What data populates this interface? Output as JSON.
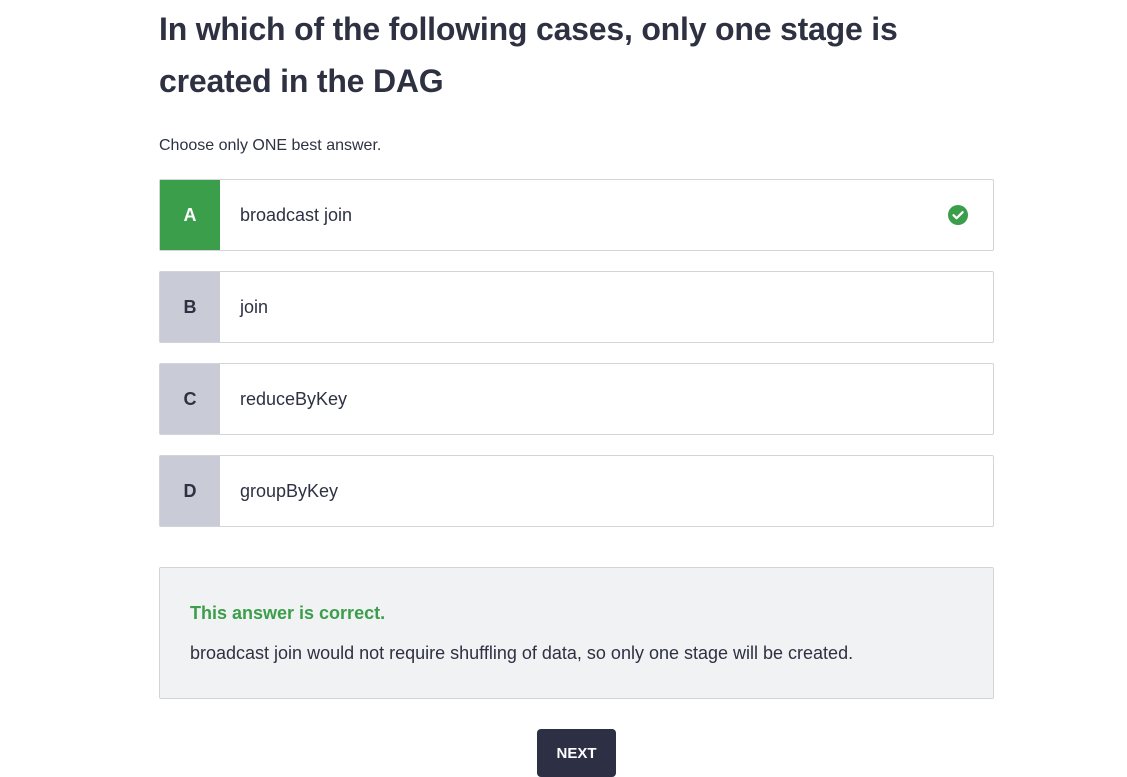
{
  "question": {
    "title": "In which of the following cases, only one stage is created in the DAG",
    "instruction": "Choose only ONE best answer."
  },
  "options": [
    {
      "letter": "A",
      "text": "broadcast join",
      "state": "correct"
    },
    {
      "letter": "B",
      "text": "join",
      "state": "unselected"
    },
    {
      "letter": "C",
      "text": "reduceByKey",
      "state": "unselected"
    },
    {
      "letter": "D",
      "text": "groupByKey",
      "state": "unselected"
    }
  ],
  "feedback": {
    "verdict": "This answer is correct.",
    "explanation": "broadcast join would not require shuffling of data, so only one stage will be created."
  },
  "next_button": {
    "label": "NEXT"
  },
  "colors": {
    "correct_green": "#3a9e4a",
    "letter_gray": "#c9ccd6",
    "text_dark": "#2d3142",
    "button_navy": "#2d2f45",
    "feedback_bg": "#f1f2f4"
  },
  "icons": {
    "correct_marker": "check-circle-icon"
  }
}
